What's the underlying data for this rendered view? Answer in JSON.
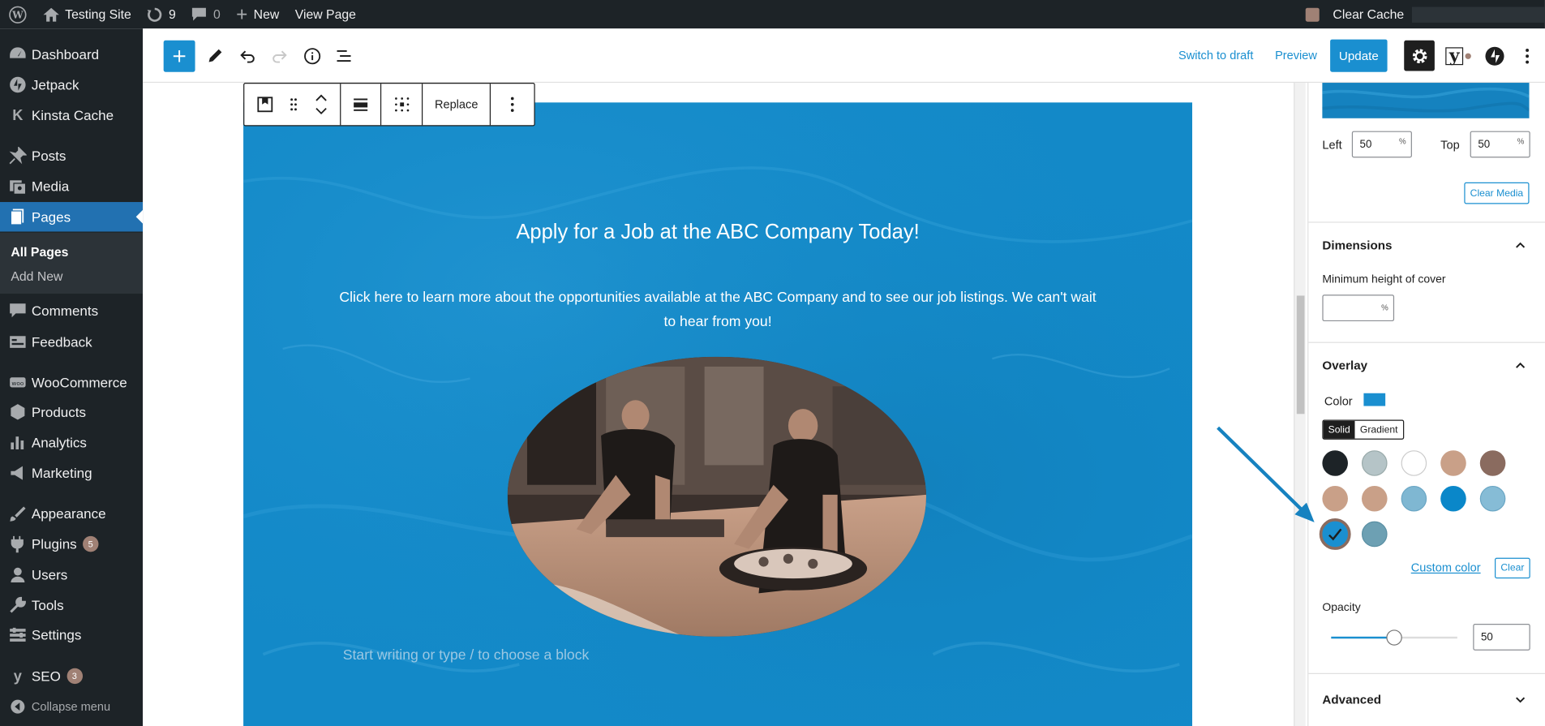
{
  "admin_bar": {
    "site_name": "Testing Site",
    "updates_count": "9",
    "comments_count": "0",
    "new_label": "New",
    "view_page_label": "View Page",
    "clear_cache_label": "Clear Cache"
  },
  "sidebar": {
    "items": [
      {
        "label": "Dashboard",
        "icon": "dashboard-icon"
      },
      {
        "label": "Jetpack",
        "icon": "jetpack-icon"
      },
      {
        "label": "Kinsta Cache",
        "icon": "kinsta-icon"
      },
      {
        "label": "Posts",
        "icon": "pin-icon"
      },
      {
        "label": "Media",
        "icon": "media-icon"
      },
      {
        "label": "Pages",
        "icon": "pages-icon"
      },
      {
        "label": "Comments",
        "icon": "comments-icon"
      },
      {
        "label": "Feedback",
        "icon": "feedback-icon"
      },
      {
        "label": "WooCommerce",
        "icon": "woocommerce-icon"
      },
      {
        "label": "Products",
        "icon": "products-icon"
      },
      {
        "label": "Analytics",
        "icon": "analytics-icon"
      },
      {
        "label": "Marketing",
        "icon": "marketing-icon"
      },
      {
        "label": "Appearance",
        "icon": "appearance-icon"
      },
      {
        "label": "Plugins",
        "icon": "plugins-icon",
        "badge": "5"
      },
      {
        "label": "Users",
        "icon": "users-icon"
      },
      {
        "label": "Tools",
        "icon": "tools-icon"
      },
      {
        "label": "Settings",
        "icon": "settings-icon"
      },
      {
        "label": "SEO",
        "icon": "yoast-icon",
        "badge": "3"
      },
      {
        "label": "Collapse menu",
        "icon": "collapse-icon"
      }
    ],
    "submenu": {
      "all_pages": "All Pages",
      "add_new": "Add New"
    }
  },
  "header": {
    "switch_to_draft": "Switch to draft",
    "preview": "Preview",
    "update": "Update"
  },
  "block_toolbar": {
    "replace": "Replace"
  },
  "cover": {
    "title": "Apply for a Job at the ABC Company Today!",
    "text": "Click here to learn more about the opportunities available at the ABC Company and to see our job listings. We can't wait to hear from you!",
    "placeholder": "Start writing or type / to choose a block",
    "background_color": "#1389c8"
  },
  "panel": {
    "focal_left_label": "Left",
    "focal_left_value": "50",
    "focal_top_label": "Top",
    "focal_top_value": "50",
    "unit": "%",
    "clear_media": "Clear Media",
    "dimensions": {
      "title": "Dimensions",
      "min_height_label": "Minimum height of cover",
      "min_height_value": "",
      "unit": "%"
    },
    "overlay": {
      "title": "Overlay",
      "color_label": "Color",
      "color_value": "#1a8fd0",
      "solid": "Solid",
      "gradient": "Gradient",
      "palette": [
        "#1d2327",
        "#b5c4c7",
        "#ffffff",
        "#c9a088",
        "#8a6b5f",
        "#c9a088",
        "#c9a088",
        "#7fb7d2",
        "#0a87c9",
        "#86bcd6",
        "#1a8fd0",
        "#6da0b3"
      ],
      "selected_index": 10,
      "custom_color": "Custom color",
      "clear": "Clear",
      "opacity_label": "Opacity",
      "opacity_value": "50"
    },
    "advanced": "Advanced"
  },
  "colors": {
    "accent": "#1a8fd0",
    "admin_bg": "#1d2327",
    "arrow": "#1682c0"
  }
}
